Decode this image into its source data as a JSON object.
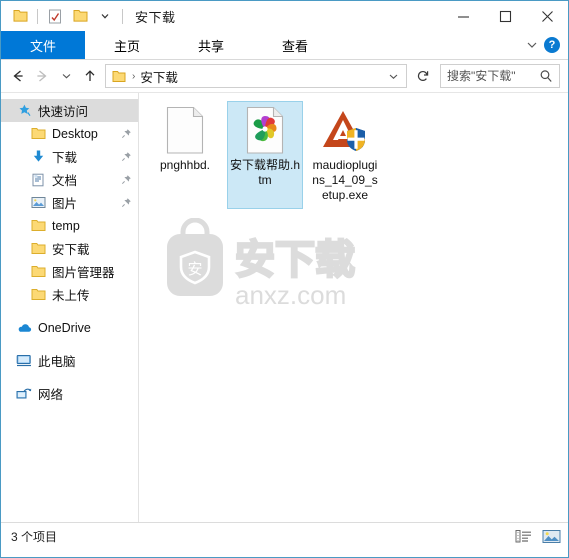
{
  "window": {
    "title": "安下载",
    "accent_color": "#0078d7",
    "border_color": "#4a9ac4",
    "selection_fill": "#cce8f6",
    "selection_border": "#99d1ea"
  },
  "quick_access_toolbar": {
    "items": [
      {
        "name": "folder-icon",
        "label": "属性"
      },
      {
        "name": "properties-check-icon",
        "label": "属性"
      },
      {
        "name": "new-folder-icon",
        "label": "新建文件夹"
      },
      {
        "name": "customize-dropdown-icon",
        "label": "自定义快速访问工具栏"
      }
    ]
  },
  "window_controls": {
    "minimize": "—",
    "maximize": "□",
    "close": "✕"
  },
  "ribbon": {
    "tabs": [
      {
        "label": "文件",
        "active": true
      },
      {
        "label": "主页",
        "active": false
      },
      {
        "label": "共享",
        "active": false
      },
      {
        "label": "查看",
        "active": false
      }
    ],
    "expand_label": "展开功能区",
    "help_label": "?"
  },
  "address_bar": {
    "back_label": "后退",
    "forward_label": "前进",
    "recent_label": "最近使用的位置",
    "up_label": "上移到上一级",
    "breadcrumb": [
      {
        "label": "安下载"
      }
    ],
    "breadcrumb_separator": "›",
    "dropdown_label": "以前的位置",
    "refresh_label": "刷新",
    "search": {
      "placeholder": "搜索\"安下载\"",
      "value": ""
    }
  },
  "sidebar": {
    "items": [
      {
        "label": "快速访问",
        "icon": "star-pin-icon",
        "selected": true,
        "indent": "root",
        "pinned": false
      },
      {
        "label": "Desktop",
        "icon": "folder-icon",
        "selected": false,
        "indent": "child",
        "pinned": true
      },
      {
        "label": "下载",
        "icon": "download-arrow-icon",
        "selected": false,
        "indent": "child",
        "pinned": true
      },
      {
        "label": "文档",
        "icon": "documents-icon",
        "selected": false,
        "indent": "child",
        "pinned": true
      },
      {
        "label": "图片",
        "icon": "pictures-icon",
        "selected": false,
        "indent": "child",
        "pinned": true
      },
      {
        "label": "temp",
        "icon": "folder-icon",
        "selected": false,
        "indent": "child",
        "pinned": false
      },
      {
        "label": "安下载",
        "icon": "folder-icon",
        "selected": false,
        "indent": "child",
        "pinned": false
      },
      {
        "label": "图片管理器",
        "icon": "folder-icon",
        "selected": false,
        "indent": "child",
        "pinned": false
      },
      {
        "label": "未上传",
        "icon": "folder-icon",
        "selected": false,
        "indent": "child",
        "pinned": false
      },
      {
        "label": "OneDrive",
        "icon": "onedrive-cloud-icon",
        "selected": false,
        "indent": "root",
        "pinned": false
      },
      {
        "label": "此电脑",
        "icon": "this-pc-icon",
        "selected": false,
        "indent": "root",
        "pinned": false
      },
      {
        "label": "网络",
        "icon": "network-icon",
        "selected": false,
        "indent": "root",
        "pinned": false
      }
    ]
  },
  "files": [
    {
      "name": "pnghhbd.",
      "icon": "blank-document-icon",
      "selected": false
    },
    {
      "name": "安下载帮助.htm",
      "icon": "html-pinwheel-icon",
      "selected": true
    },
    {
      "name": "maudioplugins_14_09_setup.exe",
      "icon": "installer-shield-icon",
      "selected": false
    }
  ],
  "watermark": {
    "brand_text": "安下载",
    "site_text": "anxz.com",
    "badge_char": "安",
    "color": "#dcdcdc"
  },
  "status_bar": {
    "item_count_text": "3 个项目",
    "views": [
      {
        "name": "details-view-button",
        "label": "详细信息",
        "active": false
      },
      {
        "name": "large-icons-view-button",
        "label": "大图标",
        "active": true
      }
    ]
  }
}
